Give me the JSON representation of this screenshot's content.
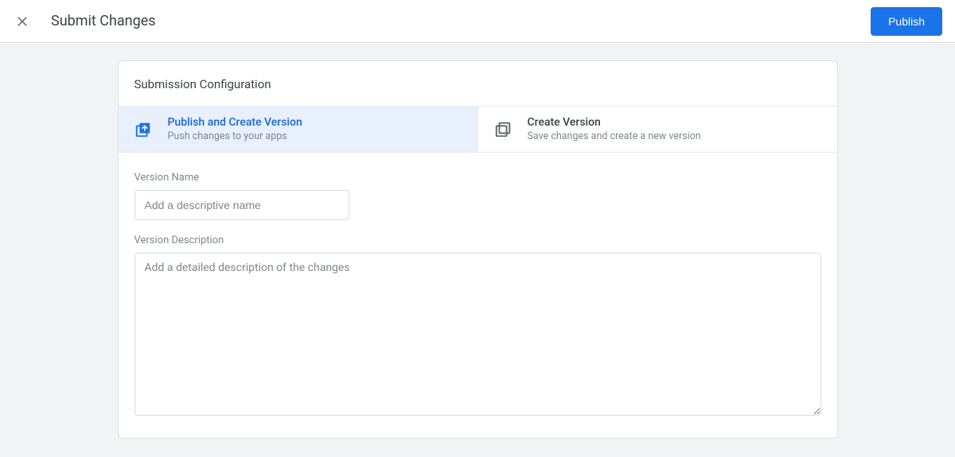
{
  "header": {
    "title": "Submit Changes",
    "publish_label": "Publish"
  },
  "card": {
    "title": "Submission Configuration"
  },
  "options": {
    "publish_create": {
      "title": "Publish and Create Version",
      "sub": "Push changes to your apps"
    },
    "create_version": {
      "title": "Create Version",
      "sub": "Save changes and create a new version"
    }
  },
  "form": {
    "version_name_label": "Version Name",
    "version_name_placeholder": "Add a descriptive name",
    "version_name_value": "",
    "version_desc_label": "Version Description",
    "version_desc_placeholder": "Add a detailed description of the changes",
    "version_desc_value": ""
  }
}
